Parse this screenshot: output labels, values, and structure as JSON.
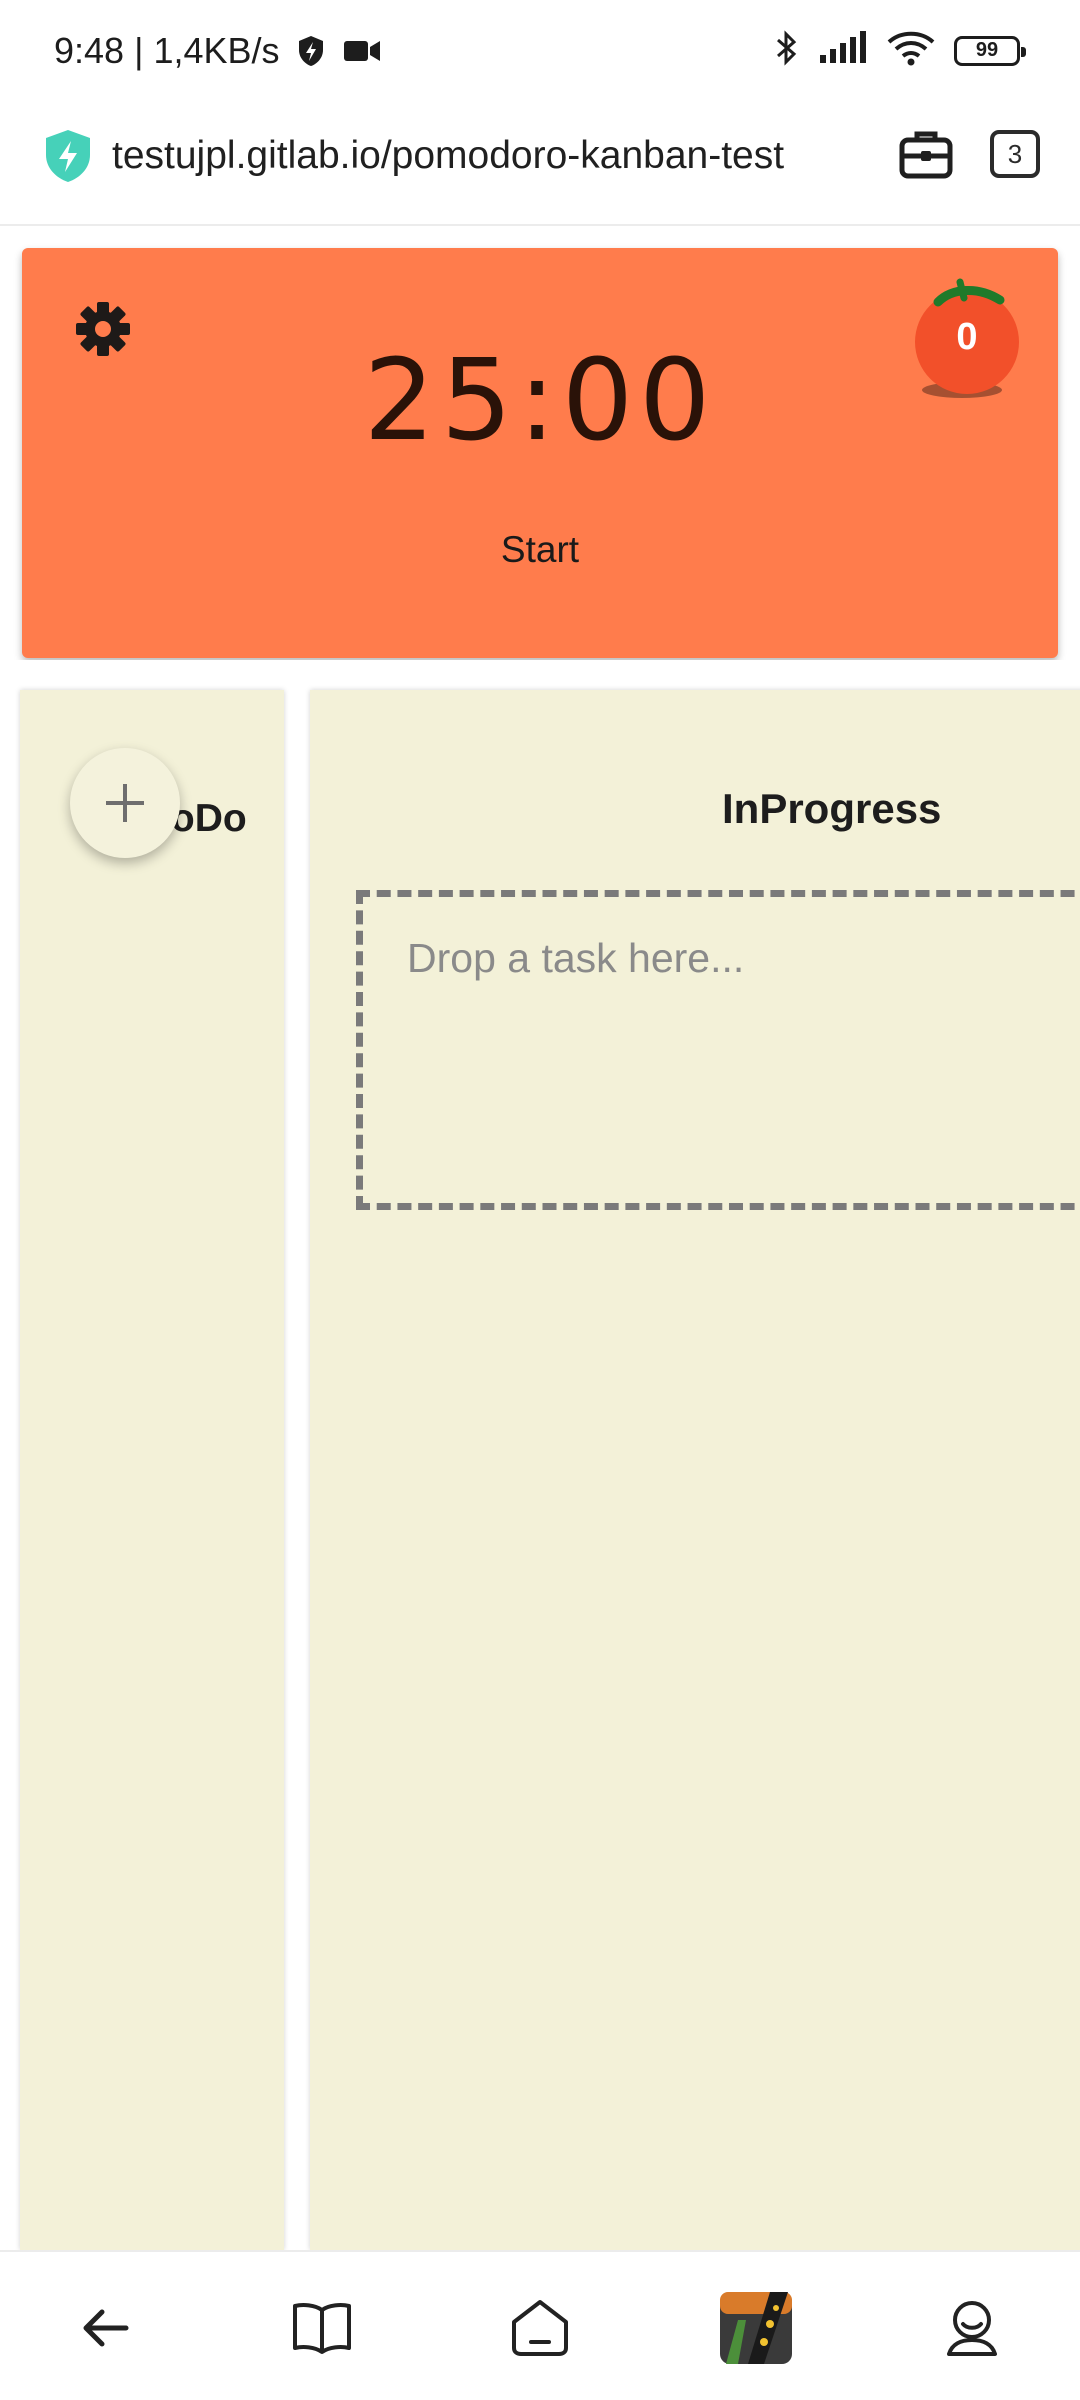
{
  "status_bar": {
    "time": "9:48",
    "separator": "|",
    "network_speed": "1,4KB/s",
    "left_icons": [
      "shield-bolt-icon",
      "video-camera-icon"
    ],
    "right_icons": [
      "bluetooth-icon",
      "signal-icon",
      "wifi-icon"
    ],
    "battery_level": "99"
  },
  "browser": {
    "url": "testujpl.gitlab.io/pomodoro-kanban-test",
    "tab_count": "3",
    "icons": [
      "secure-shield-icon",
      "toolbox-icon"
    ]
  },
  "timer": {
    "display": "25:00",
    "start_label": "Start",
    "pomodoro_count": "0",
    "accent_color": "#ff7c4c"
  },
  "board": {
    "columns": [
      {
        "title": "ToDo"
      },
      {
        "title": "InProgress",
        "dropzone_text": "Drop a task here..."
      }
    ],
    "add_button_icon": "plus-icon",
    "column_color": "#f3f1d8"
  },
  "bottom_nav": {
    "items": [
      "back-arrow-icon",
      "book-icon",
      "home-icon",
      "game-thumbnail-icon",
      "profile-icon"
    ]
  }
}
